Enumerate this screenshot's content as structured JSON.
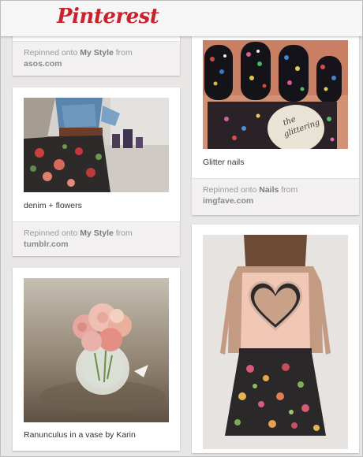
{
  "header": {
    "logo": "Pinterest"
  },
  "pins": {
    "p0": {
      "repin_prefix": "Repinned onto",
      "board": "My Style",
      "from": "from",
      "source": "asos.com"
    },
    "p1": {
      "description": "denim + flowers",
      "repin_prefix": "Repinned onto",
      "board": "My Style",
      "from": "from",
      "source": "tumblr.com"
    },
    "p2": {
      "description": "Ranunculus in a vase by Karin"
    },
    "p3": {
      "description": "Glitter nails",
      "repin_prefix": "Repinned onto",
      "board": "Nails",
      "from": "from",
      "source": "imgfave.com"
    },
    "p4": {}
  }
}
